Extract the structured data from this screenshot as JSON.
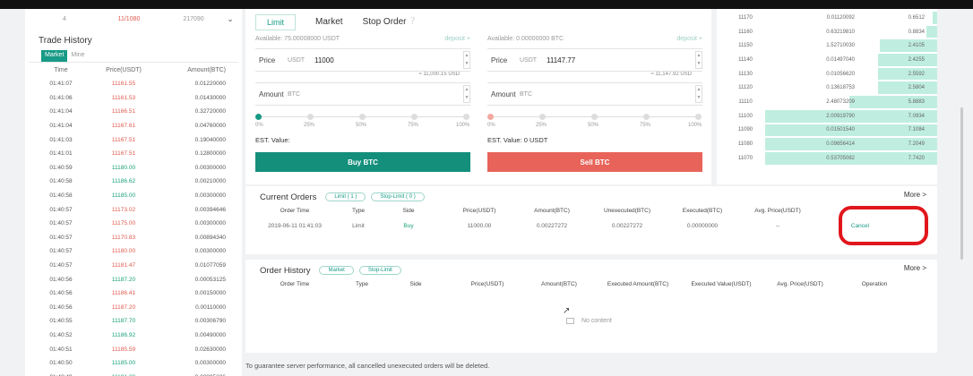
{
  "left_top": {
    "time": "4",
    "price": "11/1080",
    "amount": "217090"
  },
  "trade_history": {
    "title": "Trade History",
    "tabs": [
      "Market",
      "Mine"
    ],
    "headers": [
      "Time",
      "Price(USDT)",
      "Amount(BTC)"
    ],
    "rows": [
      {
        "time": "01:41:07",
        "price": "11161.55",
        "amount": "0.01220000",
        "dir": "down"
      },
      {
        "time": "01:41:06",
        "price": "11161.53",
        "amount": "0.01430000",
        "dir": "down"
      },
      {
        "time": "01:41:04",
        "price": "11166.51",
        "amount": "0.32720000",
        "dir": "down"
      },
      {
        "time": "01:41:04",
        "price": "11167.61",
        "amount": "0.04760000",
        "dir": "down"
      },
      {
        "time": "01:41:03",
        "price": "11167.51",
        "amount": "0.19040000",
        "dir": "down"
      },
      {
        "time": "01:41:01",
        "price": "11167.51",
        "amount": "0.12800000",
        "dir": "down"
      },
      {
        "time": "01:40:59",
        "price": "11180.00",
        "amount": "0.00300000",
        "dir": "up"
      },
      {
        "time": "01:40:58",
        "price": "11186.62",
        "amount": "0.00210000",
        "dir": "up"
      },
      {
        "time": "01:40:58",
        "price": "11185.00",
        "amount": "0.00300000",
        "dir": "up"
      },
      {
        "time": "01:40:57",
        "price": "11173.02",
        "amount": "0.00394646",
        "dir": "down"
      },
      {
        "time": "01:40:57",
        "price": "11175.00",
        "amount": "0.00300000",
        "dir": "down"
      },
      {
        "time": "01:40:57",
        "price": "11170.83",
        "amount": "0.00894340",
        "dir": "down"
      },
      {
        "time": "01:40:57",
        "price": "11180.00",
        "amount": "0.00300000",
        "dir": "down"
      },
      {
        "time": "01:40:57",
        "price": "11181.47",
        "amount": "0.01077059",
        "dir": "down"
      },
      {
        "time": "01:40:56",
        "price": "11187.20",
        "amount": "0.00053125",
        "dir": "up"
      },
      {
        "time": "01:40:56",
        "price": "11186.41",
        "amount": "0.00150000",
        "dir": "down"
      },
      {
        "time": "01:40:56",
        "price": "11187.20",
        "amount": "0.00110000",
        "dir": "down"
      },
      {
        "time": "01:40:55",
        "price": "11187.70",
        "amount": "0.00306790",
        "dir": "up"
      },
      {
        "time": "01:40:52",
        "price": "11186.92",
        "amount": "0.00490000",
        "dir": "up"
      },
      {
        "time": "01:40:51",
        "price": "11185.59",
        "amount": "0.02630000",
        "dir": "down"
      },
      {
        "time": "01:40:50",
        "price": "11185.00",
        "amount": "0.00300000",
        "dir": "up"
      },
      {
        "time": "01:40:49",
        "price": "11191.20",
        "amount": "0.00895226",
        "dir": "up"
      }
    ]
  },
  "order_form": {
    "tabs": [
      "Limit",
      "Market",
      "Stop Order"
    ],
    "buy": {
      "available": "Available: 75.00008000 USDT",
      "deposit": "deposit +",
      "price_label": "Price",
      "price_unit": "USDT",
      "price_value": "11000",
      "approx": "≈ 11,000.15 USD",
      "amount_label": "Amount",
      "amount_unit": "BTC",
      "est": "EST. Value:",
      "button": "Buy BTC"
    },
    "sell": {
      "available": "Available: 0.00000000 BTC",
      "deposit": "deposit +",
      "price_label": "Price",
      "price_unit": "USDT",
      "price_value": "11147.77",
      "approx": "≈ 11,147.92 USD",
      "amount_label": "Amount",
      "amount_unit": "BTC",
      "est": "EST. Value: 0 USDT",
      "button": "Sell BTC"
    },
    "percents": [
      "0%",
      "25%",
      "50%",
      "75%",
      "100%"
    ]
  },
  "order_book": [
    {
      "price": "11170",
      "amount": "0.01120092",
      "total": "0.6512",
      "depth": 0.02
    },
    {
      "price": "11160",
      "amount": "0.63219810",
      "total": "0.8834",
      "depth": 0.05
    },
    {
      "price": "11150",
      "amount": "1.52710030",
      "total": "2.4105",
      "depth": 0.26
    },
    {
      "price": "11140",
      "amount": "0.01497040",
      "total": "2.4255",
      "depth": 0.27
    },
    {
      "price": "11130",
      "amount": "0.01056620",
      "total": "2.5592",
      "depth": 0.27
    },
    {
      "price": "11120",
      "amount": "0.13618753",
      "total": "2.5804",
      "depth": 0.27
    },
    {
      "price": "11110",
      "amount": "2.48073209",
      "total": "5.8883",
      "depth": 0.4
    },
    {
      "price": "11100",
      "amount": "2.00919790",
      "total": "7.0934",
      "depth": 0.78
    },
    {
      "price": "11090",
      "amount": "0.01501540",
      "total": "7.1084",
      "depth": 0.78
    },
    {
      "price": "11080",
      "amount": "0.09656414",
      "total": "7.2049",
      "depth": 0.78
    },
    {
      "price": "11070",
      "amount": "0.53705082",
      "total": "7.7420",
      "depth": 0.78
    }
  ],
  "current_orders": {
    "title": "Current Orders",
    "pills": [
      "Limit ( 1 )",
      "Stop-Limit ( 0 )"
    ],
    "more": "More >",
    "headers": [
      "Order Time",
      "Type",
      "Side",
      "Price(USDT)",
      "Amount(BTC)",
      "Unexecuted(BTC)",
      "Executed(BTC)",
      "Avg. Price(USDT)"
    ],
    "row": {
      "time": "2019-06-11 01:41:03",
      "type": "Limit",
      "side": "Buy",
      "price": "11000.00",
      "amount": "0.00227272",
      "unexecuted": "0.00227272",
      "executed": "0.00000000",
      "avg": "--",
      "action": "Cancel"
    }
  },
  "order_history": {
    "title": "Order History",
    "pills": [
      "Market",
      "Stop-Limit"
    ],
    "more": "More >",
    "headers": [
      "Order Time",
      "Type",
      "Side",
      "Price(USDT)",
      "Amount(BTC)",
      "Executed Amount(BTC)",
      "Executed Value(USDT)",
      "Avg. Price(USDT)",
      "Operation"
    ],
    "empty": "No content"
  },
  "footnote": "To guarantee server performance, all cancelled unexecuted orders will be deleted.",
  "colors": {
    "accent": "#179a86",
    "sell": "#e8645a",
    "highlight": "#e1161d"
  }
}
